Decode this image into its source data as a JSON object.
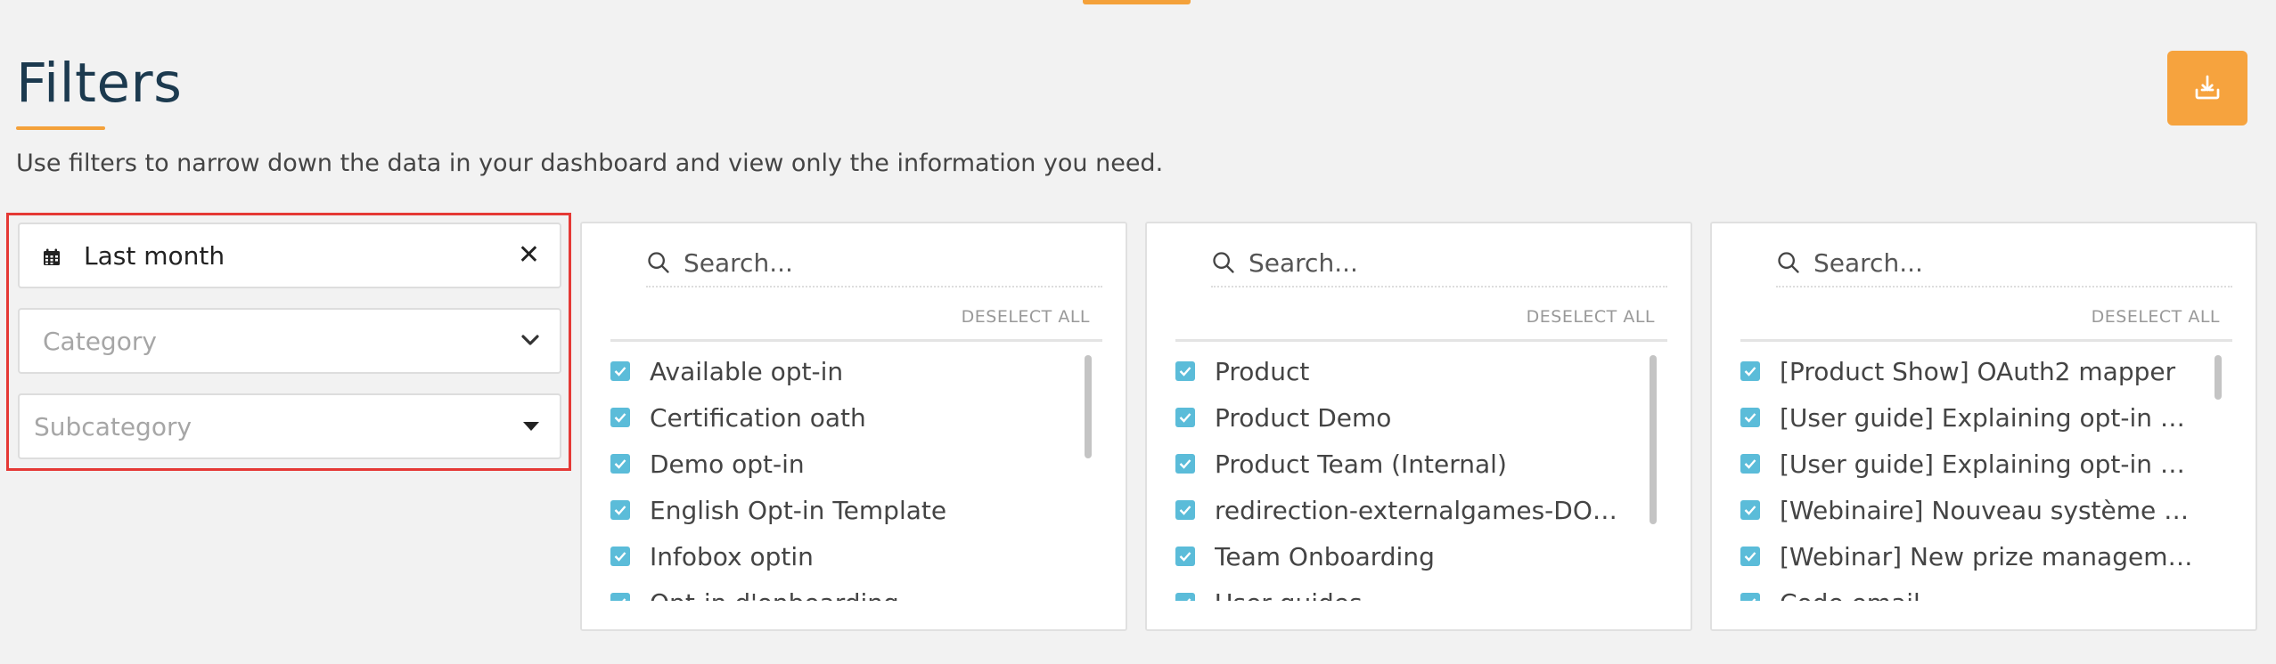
{
  "page": {
    "title": "Filters",
    "subtitle": "Use filters to narrow down the data in your dashboard and view only the information you need."
  },
  "colors": {
    "accent": "#f4a13a",
    "checkbox": "#5bbcd9",
    "highlight_border": "#e53935",
    "title": "#1c3a4f"
  },
  "filters": {
    "date": {
      "value": "Last month",
      "icon": "calendar-icon",
      "clear_icon": "close-icon"
    },
    "category": {
      "placeholder": "Category",
      "icon": "chevron-down-icon"
    },
    "subcategory": {
      "placeholder": "Subcategory",
      "icon": "caret-down-icon"
    }
  },
  "lists": [
    {
      "search_placeholder": "Search...",
      "deselect_label": "DESELECT ALL",
      "items": [
        {
          "label": "Available opt-in",
          "checked": true
        },
        {
          "label": "Certification oath",
          "checked": true
        },
        {
          "label": "Demo opt-in",
          "checked": true
        },
        {
          "label": "English Opt-in Template",
          "checked": true
        },
        {
          "label": "Infobox optin",
          "checked": true
        },
        {
          "label": "Opt-in d'onboarding",
          "checked": true
        }
      ]
    },
    {
      "search_placeholder": "Search...",
      "deselect_label": "DESELECT ALL",
      "items": [
        {
          "label": "Product",
          "checked": true
        },
        {
          "label": "Product Demo",
          "checked": true
        },
        {
          "label": "Product Team (Internal)",
          "checked": true
        },
        {
          "label": "redirection-externalgames-DONOTUSE",
          "checked": true
        },
        {
          "label": "Team Onboarding",
          "checked": true
        },
        {
          "label": "User guides",
          "checked": true
        }
      ]
    },
    {
      "search_placeholder": "Search...",
      "deselect_label": "DESELECT ALL",
      "items": [
        {
          "label": "[Product Show] OAuth2 mapper",
          "checked": true
        },
        {
          "label": "[User guide] Explaining opt-in categories",
          "checked": true
        },
        {
          "label": "[User guide] Explaining opt-in categories",
          "checked": true
        },
        {
          "label": "[Webinaire] Nouveau système de gestion",
          "checked": true
        },
        {
          "label": "[Webinar] New prize management system",
          "checked": true
        },
        {
          "label": "Code email",
          "checked": true
        }
      ]
    }
  ]
}
